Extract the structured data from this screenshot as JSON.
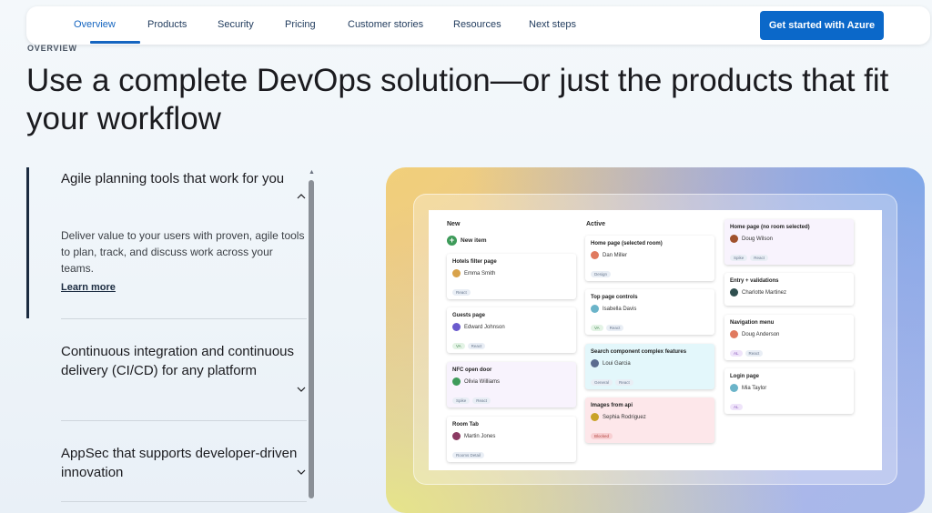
{
  "nav": {
    "items": [
      "Overview",
      "Products",
      "Security",
      "Pricing",
      "Customer stories",
      "Resources",
      "Next steps"
    ],
    "active": "Overview",
    "cta_label": "Get started with Azure"
  },
  "hero": {
    "eyebrow": "OVERVIEW",
    "headline": "Use a complete DevOps solution—or just the products that fit your workflow"
  },
  "accordion": {
    "items": [
      {
        "title": "Agile planning tools that work for you",
        "expanded": true,
        "description": "Deliver value to your users with proven, agile tools to plan, track, and discuss work across your teams.",
        "link": "Learn more"
      },
      {
        "title": "Continuous integration and continuous delivery (CI/CD) for any platform",
        "expanded": false
      },
      {
        "title": "AppSec that supports developer-driven innovation",
        "expanded": false
      }
    ]
  },
  "board": {
    "columns": [
      {
        "title": "New",
        "new_item_label": "New item",
        "cards": [
          {
            "title": "Hotels filter page",
            "person": "Emma Smith",
            "tags": [
              "React"
            ],
            "style": "white",
            "avatar": "#d8a24a"
          },
          {
            "title": "Guests page",
            "person": "Edward Johnson",
            "tags": [
              "VA",
              "React"
            ],
            "style": "white",
            "avatar": "#6a5acd"
          },
          {
            "title": "NFC open door",
            "person": "Olivia Williams",
            "tags": [
              "Spike",
              "React"
            ],
            "style": "purple",
            "avatar": "#3e9b5a"
          },
          {
            "title": "Room Tab",
            "person": "Martin Jones",
            "tags": [
              "Rooms Detail"
            ],
            "style": "white",
            "avatar": "#8b3a62"
          }
        ]
      },
      {
        "title": "Active",
        "cards": [
          {
            "title": "Home page (selected room)",
            "person": "Dan Miller",
            "tags": [
              "Design"
            ],
            "style": "white",
            "avatar": "#e07a5f"
          },
          {
            "title": "Top page controls",
            "person": "Isabella Davis",
            "tags": [
              "VA",
              "React"
            ],
            "style": "white",
            "avatar": "#6bb4c9"
          },
          {
            "title": "Search component complex features",
            "person": "Loui Garcia",
            "tags": [
              "General",
              "React"
            ],
            "style": "cyan",
            "avatar": "#5b6c8f"
          },
          {
            "title": "Images from api",
            "person": "Sephia Rodriguez",
            "tags": [
              "Blocked"
            ],
            "style": "pink",
            "avatar": "#c9a227"
          }
        ]
      },
      {
        "title": "",
        "cards": [
          {
            "title": "Home page (no room selected)",
            "person": "Doug Wilson",
            "tags": [
              "Spike",
              "React"
            ],
            "style": "purple",
            "avatar": "#a0522d"
          },
          {
            "title": "Entry + validations",
            "person": "Charlotte Martinez",
            "tags": [],
            "style": "white",
            "avatar": "#2f4f4f"
          },
          {
            "title": "Navigation menu",
            "person": "Doug Anderson",
            "tags": [
              "AL",
              "React"
            ],
            "style": "white",
            "avatar": "#e07a5f"
          },
          {
            "title": "Login page",
            "person": "Mia Taylor",
            "tags": [
              "AL"
            ],
            "style": "white",
            "avatar": "#6bb4c9"
          }
        ]
      }
    ]
  }
}
